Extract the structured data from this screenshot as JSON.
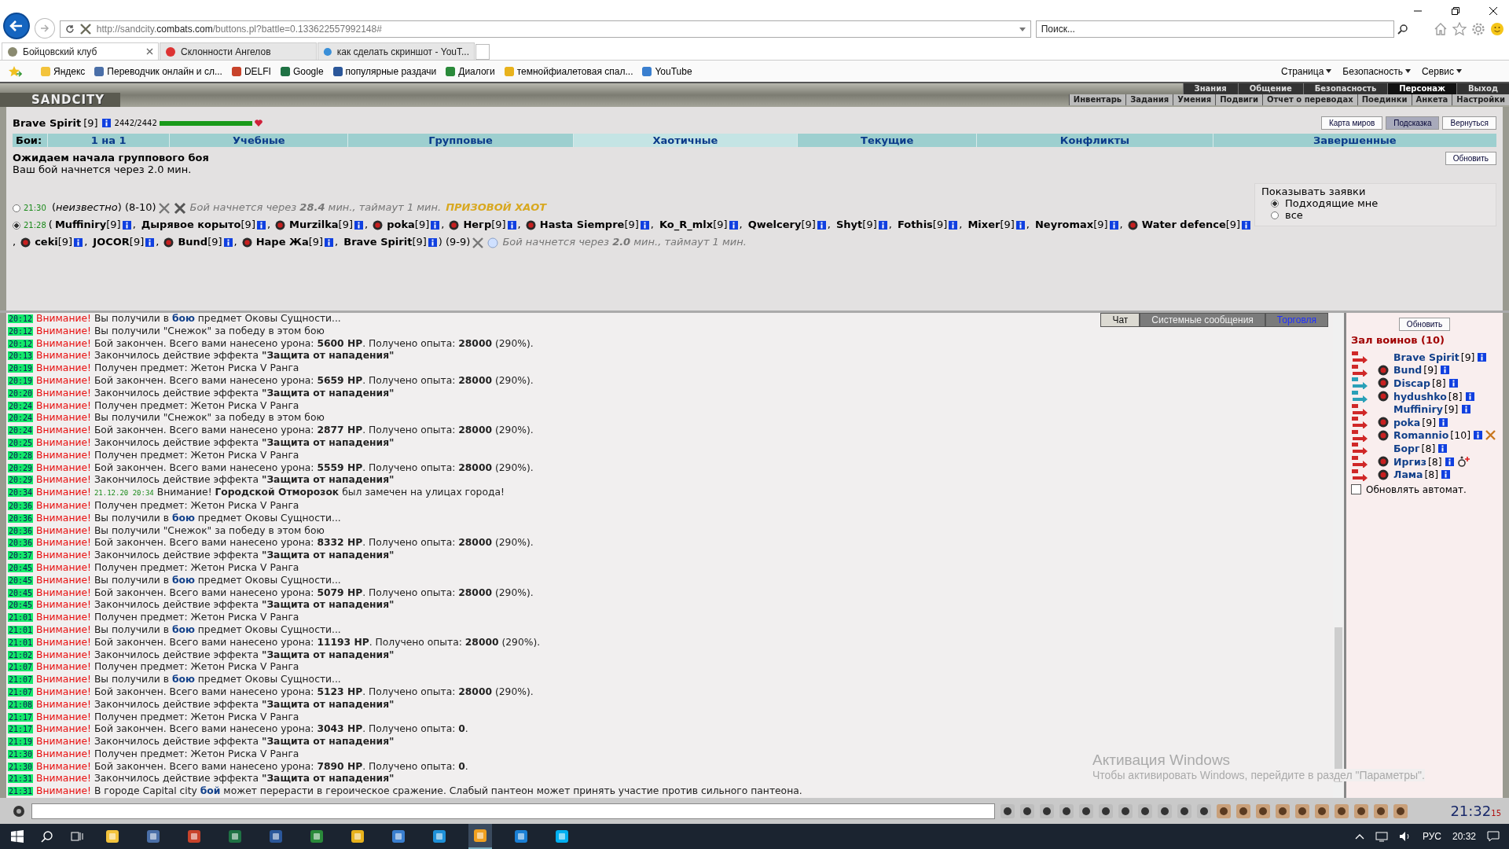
{
  "browser": {
    "address": "http://sandcity.**combats.com**/buttons.pl?battle=0.133622557992148#",
    "search": {
      "placeholder": "Поиск..."
    },
    "tabs": [
      {
        "label": "Бойцовский клуб",
        "selected": true
      },
      {
        "label": "Склонности Ангелов",
        "selected": false
      },
      {
        "label": "как сделать скриншот - YouT...",
        "selected": false
      }
    ],
    "favorites": [
      "Яндекс",
      "Переводчик онлайн и сл...",
      "DELFI",
      "Google",
      "популярные раздачи",
      "Диалоги",
      "темнойфиалетовая спал...",
      "YouTube"
    ],
    "commands": [
      "Страница",
      "Безопасность",
      "Сервис"
    ]
  },
  "game": {
    "logo": "SANDCITY",
    "menu_top": [
      {
        "label": "Знания",
        "selected": false
      },
      {
        "label": "Общение",
        "selected": false
      },
      {
        "label": "Безопасность",
        "selected": false
      },
      {
        "label": "Персонаж",
        "selected": true
      },
      {
        "label": "Выход",
        "selected": false
      }
    ],
    "menu_bottom": [
      "Инвентарь",
      "Задания",
      "Умения",
      "Подвиги",
      "Отчет о переводах",
      "Поединки",
      "Анкета",
      "Настройки"
    ]
  },
  "player": {
    "name": "Brave Spirit",
    "level": "[9]",
    "hp": "2442/2442",
    "health": {
      "level": 1
    }
  },
  "top_buttons": [
    {
      "label": "Карта миров",
      "selected": false
    },
    {
      "label": "Подсказка",
      "selected": true
    },
    {
      "label": "Вернуться",
      "selected": false
    }
  ],
  "battle_tabs": {
    "label": "Бои:",
    "items": [
      {
        "label": "1 на 1",
        "selected": false
      },
      {
        "label": "Учебные",
        "selected": false
      },
      {
        "label": "Групповые",
        "selected": false
      },
      {
        "label": "Хаотичные",
        "selected": true
      },
      {
        "label": "Текущие",
        "selected": false
      },
      {
        "label": "Конфликты",
        "selected": false
      },
      {
        "label": "Завершенные",
        "selected": false
      }
    ]
  },
  "status": {
    "title": "Ожидаем начала группового боя",
    "subtitle": "Ваш бой начнется через 2.0 мин.",
    "refresh": "Обновить"
  },
  "filter": {
    "title": "Показывать заявки",
    "options": [
      {
        "label": "Подходящие мне",
        "selected": true
      },
      {
        "label": "все",
        "selected": false
      }
    ]
  },
  "requests": [
    {
      "time": "21:30",
      "selected": false,
      "info": "(*неизвестно*) (8-10)",
      "note": "Бой начнется через **28.4** мин., таймаут 1 мин.",
      "prize": "ПРИЗОВОЙ ХАОТ"
    },
    {
      "time": "21:28",
      "selected": true,
      "open": "(",
      "range": ") (9-9)",
      "note": "Бой начнется через **2.0** мин., таймаут 1 мин.",
      "participants": [
        {
          "name": "Muffiniry",
          "level": "[9]",
          "emblem": false,
          "after": ","
        },
        {
          "name": "Дырявое корыто",
          "level": "[9]",
          "emblem": false,
          "after": ","
        },
        {
          "name": "Murzilka",
          "level": "[9]",
          "emblem": true,
          "after": ","
        },
        {
          "name": "poka",
          "level": "[9]",
          "emblem": true,
          "after": ","
        },
        {
          "name": "Негр",
          "level": "[9]",
          "emblem": true,
          "after": ","
        },
        {
          "name": "Hasta Siempre",
          "level": "[9]",
          "emblem": true,
          "after": ","
        },
        {
          "name": "Ko_R_mlx",
          "level": "[9]",
          "emblem": false,
          "after": ","
        },
        {
          "name": "Qwelcery",
          "level": "[9]",
          "emblem": false,
          "after": ","
        },
        {
          "name": "Shyt",
          "level": "[9]",
          "emblem": false,
          "after": ","
        },
        {
          "name": "Fothis",
          "level": "[9]",
          "emblem": false,
          "after": ","
        },
        {
          "name": "Mixer",
          "level": "[9]",
          "emblem": false,
          "after": ","
        },
        {
          "name": "Neyromax",
          "level": "[9]",
          "emblem": false,
          "after": ","
        },
        {
          "name": "Water defence",
          "level": "[9]",
          "emblem": true,
          "after": ","
        },
        {
          "name": "ceki",
          "level": "[9]",
          "emblem": true,
          "after": ","
        },
        {
          "name": "JOCOR",
          "level": "[9]",
          "emblem": false,
          "after": ","
        },
        {
          "name": "Bund",
          "level": "[9]",
          "emblem": true,
          "after": ","
        },
        {
          "name": "Наре Жа",
          "level": "[9]",
          "emblem": true,
          "after": ","
        },
        {
          "name": "Brave Spirit",
          "level": "[9]",
          "emblem": false
        }
      ]
    }
  ],
  "chat": {
    "tabs": [
      {
        "label": "Чат",
        "selected": true,
        "alert": false
      },
      {
        "label": "Системные сообщения",
        "selected": false,
        "alert": false
      },
      {
        "label": "Торговля",
        "selected": false,
        "alert": true
      }
    ],
    "messages": [
      {
        "time": "20:12",
        "label": "Внимание!",
        "text": "Вы получили в",
        "link": "бою",
        "rest": "предмет Оковы Сущности..."
      },
      {
        "time": "20:12",
        "label": "Внимание!",
        "text": "Вы получили \"Снежок\" за победу в этом бою"
      },
      {
        "time": "20:12",
        "label": "Внимание!",
        "text": "Бой закончен. Всего вами нанесено урона: **5600 HP**. Получено опыта: **28000** (290%)."
      },
      {
        "time": "20:13",
        "label": "Внимание!",
        "text": "Закончилось действие эффекта **\"Защита от нападения\"**"
      },
      {
        "time": "20:19",
        "label": "Внимание!",
        "text": "Получен предмет: Жетон Риска V Ранга"
      },
      {
        "time": "20:19",
        "label": "Внимание!",
        "text": "Бой закончен. Всего вами нанесено урона: **5659 HP**. Получено опыта: **28000** (290%)."
      },
      {
        "time": "20:20",
        "label": "Внимание!",
        "text": "Закончилось действие эффекта **\"Защита от нападения\"**"
      },
      {
        "time": "20:24",
        "label": "Внимание!",
        "text": "Получен предмет: Жетон Риска V Ранга"
      },
      {
        "time": "20:24",
        "label": "Внимание!",
        "text": "Вы получили \"Снежок\" за победу в этом бою"
      },
      {
        "time": "20:24",
        "label": "Внимание!",
        "text": "Бой закончен. Всего вами нанесено урона: **2877 HP**. Получено опыта: **28000** (290%)."
      },
      {
        "time": "20:25",
        "label": "Внимание!",
        "text": "Закончилось действие эффекта **\"Защита от нападения\"**"
      },
      {
        "time": "20:28",
        "label": "Внимание!",
        "text": "Получен предмет: Жетон Риска V Ранга"
      },
      {
        "time": "20:29",
        "label": "Внимание!",
        "text": "Бой закончен. Всего вами нанесено урона: **5559 HP**. Получено опыта: **28000** (290%)."
      },
      {
        "time": "20:29",
        "label": "Внимание!",
        "text": "Закончилось действие эффекта **\"Защита от нападения\"**"
      },
      {
        "time": "20:34",
        "label": "Внимание!",
        "stamp": "21.12.20 20:34",
        "text": "Внимание! **Городской Отморозок** был замечен на улицах города!"
      },
      {
        "time": "20:36",
        "label": "Внимание!",
        "text": "Получен предмет: Жетон Риска V Ранга"
      },
      {
        "time": "20:36",
        "label": "Внимание!",
        "text": "Вы получили в",
        "link": "бою",
        "rest": "предмет Оковы Сущности..."
      },
      {
        "time": "20:36",
        "label": "Внимание!",
        "text": "Вы получили \"Снежок\" за победу в этом бою"
      },
      {
        "time": "20:36",
        "label": "Внимание!",
        "text": "Бой закончен. Всего вами нанесено урона: **8332 HP**. Получено опыта: **28000** (290%)."
      },
      {
        "time": "20:37",
        "label": "Внимание!",
        "text": "Закончилось действие эффекта **\"Защита от нападения\"**"
      },
      {
        "time": "20:45",
        "label": "Внимание!",
        "text": "Получен предмет: Жетон Риска V Ранга"
      },
      {
        "time": "20:45",
        "label": "Внимание!",
        "text": "Вы получили в",
        "link": "бою",
        "rest": "предмет Оковы Сущности..."
      },
      {
        "time": "20:45",
        "label": "Внимание!",
        "text": "Бой закончен. Всего вами нанесено урона: **5079 HP**. Получено опыта: **28000** (290%)."
      },
      {
        "time": "20:45",
        "label": "Внимание!",
        "text": "Закончилось действие эффекта **\"Защита от нападения\"**"
      },
      {
        "time": "21:01",
        "label": "Внимание!",
        "text": "Получен предмет: Жетон Риска V Ранга"
      },
      {
        "time": "21:01",
        "label": "Внимание!",
        "text": "Вы получили в",
        "link": "бою",
        "rest": "предмет Оковы Сущности..."
      },
      {
        "time": "21:01",
        "label": "Внимание!",
        "text": "Бой закончен. Всего вами нанесено урона: **11193 HP**. Получено опыта: **28000** (290%)."
      },
      {
        "time": "21:02",
        "label": "Внимание!",
        "text": "Закончилось действие эффекта **\"Защита от нападения\"**"
      },
      {
        "time": "21:07",
        "label": "Внимание!",
        "text": "Получен предмет: Жетон Риска V Ранга"
      },
      {
        "time": "21:07",
        "label": "Внимание!",
        "text": "Вы получили в",
        "link": "бою",
        "rest": "предмет Оковы Сущности..."
      },
      {
        "time": "21:07",
        "label": "Внимание!",
        "text": "Бой закончен. Всего вами нанесено урона: **5123 HP**. Получено опыта: **28000** (290%)."
      },
      {
        "time": "21:08",
        "label": "Внимание!",
        "text": "Закончилось действие эффекта **\"Защита от нападения\"**"
      },
      {
        "time": "21:17",
        "label": "Внимание!",
        "text": "Получен предмет: Жетон Риска V Ранга"
      },
      {
        "time": "21:17",
        "label": "Внимание!",
        "text": "Бой закончен. Всего вами нанесено урона: **3043 HP**. Получено опыта: **0**."
      },
      {
        "time": "21:19",
        "label": "Внимание!",
        "text": "Закончилось действие эффекта **\"Защита от нападения\"**"
      },
      {
        "time": "21:30",
        "label": "Внимание!",
        "text": "Получен предмет: Жетон Риска V Ранга"
      },
      {
        "time": "21:30",
        "label": "Внимание!",
        "text": "Бой закончен. Всего вами нанесено урона: **7890 HP**. Получено опыта: **0**."
      },
      {
        "time": "21:31",
        "label": "Внимание!",
        "text": "Закончилось действие эффекта **\"Защита от нападения\"**"
      },
      {
        "time": "21:31",
        "label": "Внимание!",
        "text": "В городе Capital city",
        "link": "бой",
        "rest": "может перерасти в героическое сражение. Слабый пантеон может принять участие против сильного пантеона."
      }
    ]
  },
  "hall": {
    "refresh": "Обновить",
    "title": "Зал воинов (10)",
    "warriors": [
      {
        "name": "Brave Spirit",
        "level": "[9]",
        "emblem": false,
        "color": "#d02828"
      },
      {
        "name": "Bund",
        "level": "[9]",
        "emblem": true,
        "color": "#d02828"
      },
      {
        "name": "Discap",
        "level": "[8]",
        "emblem": true,
        "color": "#2aa0b8"
      },
      {
        "name": "hydushko",
        "level": "[8]",
        "emblem": true,
        "color": "#2aa0b8"
      },
      {
        "name": "Muffiniry",
        "level": "[9]",
        "emblem": false,
        "color": "#d02828"
      },
      {
        "name": "poka",
        "level": "[9]",
        "emblem": true,
        "color": "#d02828"
      },
      {
        "name": "Romannio",
        "level": "[10]",
        "emblem": true,
        "color": "#d02828",
        "kind": "cross"
      },
      {
        "name": "Борг",
        "level": "[8]",
        "emblem": false,
        "color": "#d02828"
      },
      {
        "name": "Иргиз",
        "level": "[8]",
        "emblem": true,
        "color": "#d02828",
        "kind": "plus"
      },
      {
        "name": "Лама",
        "level": "[8]",
        "emblem": true,
        "color": "#d02828"
      }
    ],
    "auto_refresh": {
      "label": "Обновлять автомат.",
      "checked": false
    }
  },
  "clock": {
    "time": "21:32",
    "seconds": "15"
  },
  "taskbar": {
    "language": "РУС",
    "time": "20:32"
  },
  "os_notice": {
    "title": "Активация Windows",
    "text": "Чтобы активировать Windows, перейдите в раздел \"Параметры\"."
  }
}
